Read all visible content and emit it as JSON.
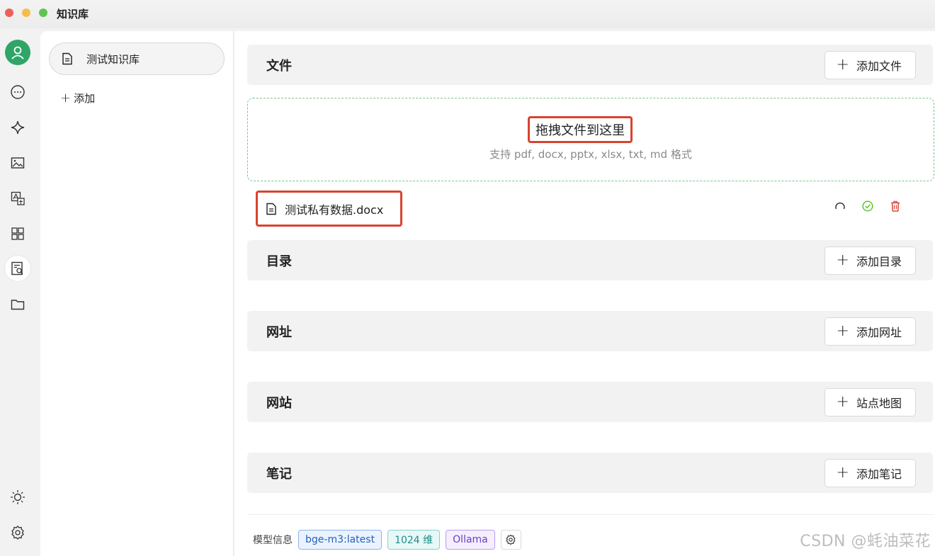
{
  "window": {
    "title": "知识库"
  },
  "rail": {
    "items": [
      {
        "name": "avatar"
      },
      {
        "name": "chat-icon"
      },
      {
        "name": "sparkle-icon"
      },
      {
        "name": "image-icon"
      },
      {
        "name": "translate-icon"
      },
      {
        "name": "apps-grid-icon"
      },
      {
        "name": "knowledge-icon"
      },
      {
        "name": "folder-icon"
      },
      {
        "name": "theme-sun-icon"
      },
      {
        "name": "settings-icon"
      }
    ]
  },
  "kb_list": {
    "items": [
      {
        "label": "测试知识库"
      }
    ],
    "add_label": "添加"
  },
  "files": {
    "title": "文件",
    "add_button": "添加文件",
    "drop_title": "拖拽文件到这里",
    "drop_hint": "支持 pdf, docx, pptx, xlsx, txt, md 格式",
    "items": [
      {
        "name": "测试私有数据.docx"
      }
    ]
  },
  "directories": {
    "title": "目录",
    "add_button": "添加目录"
  },
  "urls": {
    "title": "网址",
    "add_button": "添加网址"
  },
  "websites": {
    "title": "网站",
    "add_button": "站点地图"
  },
  "notes": {
    "title": "笔记",
    "add_button": "添加笔记"
  },
  "model_info": {
    "label": "模型信息",
    "model": "bge-m3:latest",
    "dimensions": "1024 维",
    "provider": "Ollama"
  },
  "watermark": "CSDN @蚝油菜花",
  "colors": {
    "accent_green": "#2fa567",
    "highlight_red": "#d9432e",
    "delete_red": "#e0453a",
    "success_green": "#52c41a"
  }
}
